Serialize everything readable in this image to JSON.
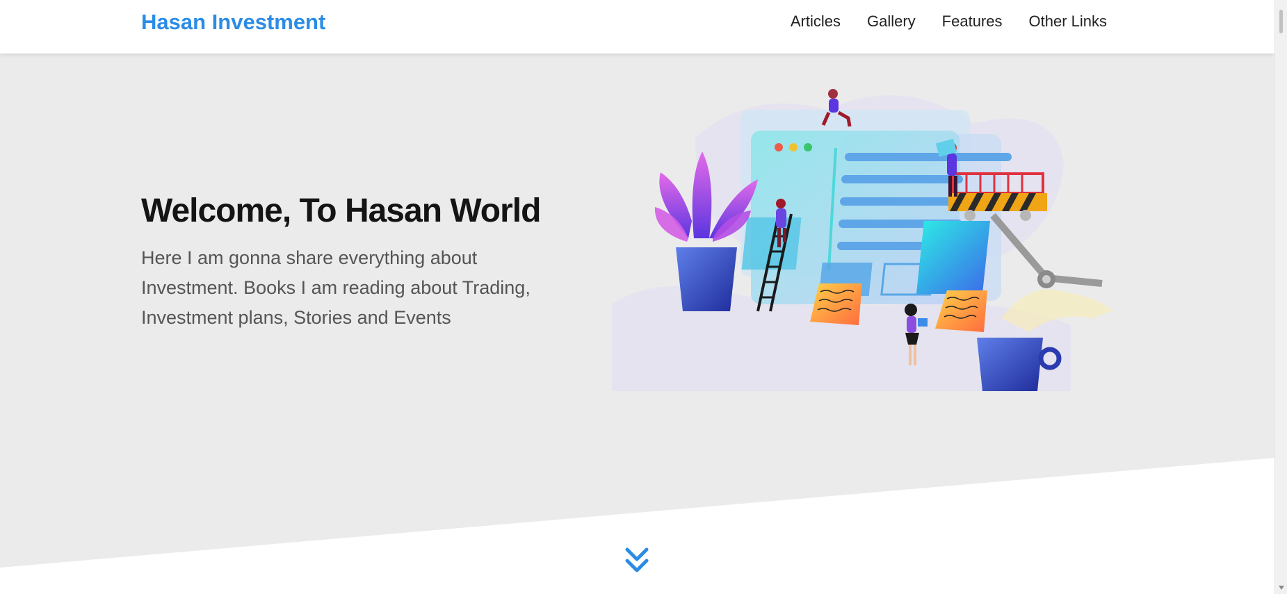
{
  "header": {
    "brand": "Hasan Investment",
    "nav": [
      "Articles",
      "Gallery",
      "Features",
      "Other Links"
    ]
  },
  "hero": {
    "title": "Welcome, To Hasan World",
    "text": "Here I am gonna share everything about Investment. Books I am reading about Trading, Investment plans, Stories and Events"
  },
  "colors": {
    "brand": "#2b8ce6",
    "hero_bg": "#ebebeb",
    "heading": "#141414",
    "body_text": "#555555"
  },
  "icons": {
    "scroll_down": "double-chevron-down-icon"
  }
}
